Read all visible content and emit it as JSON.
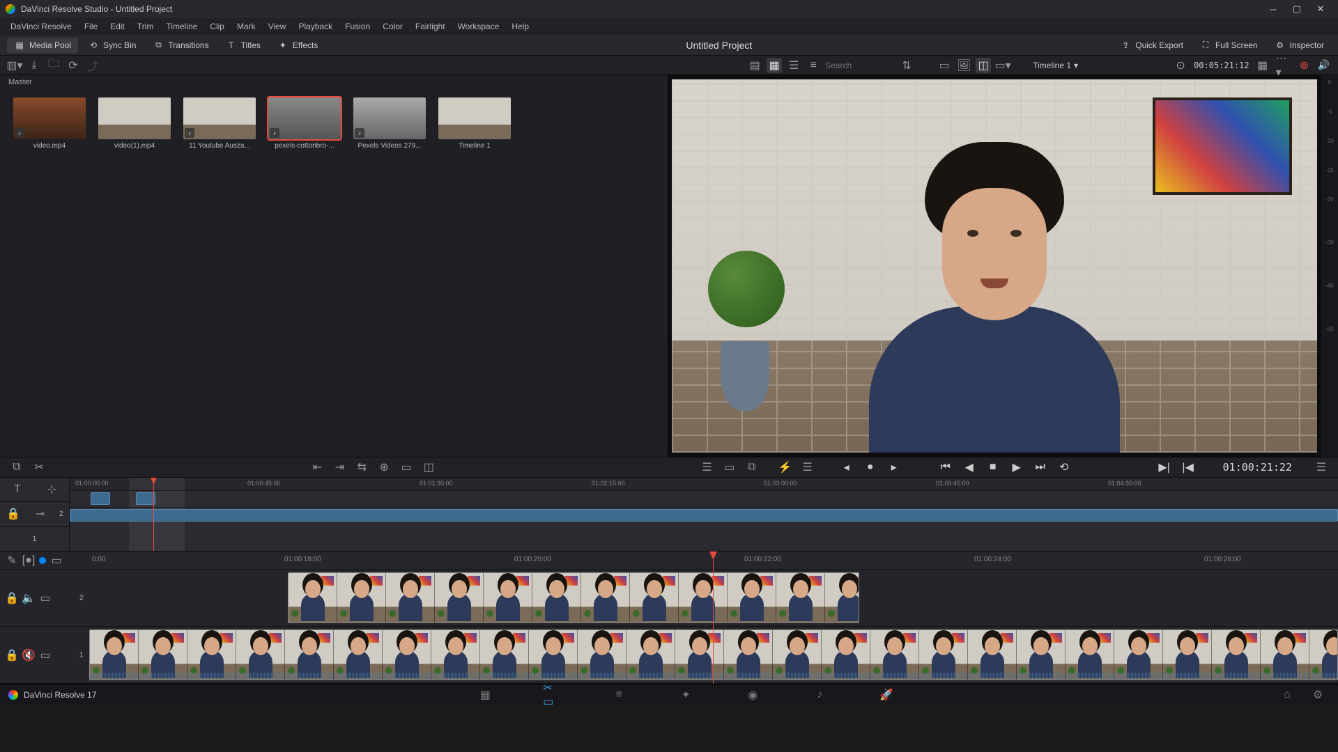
{
  "app": {
    "title": "DaVinci Resolve Studio - Untitled Project",
    "project_name": "Untitled Project",
    "version_label": "DaVinci Resolve 17"
  },
  "menu": [
    "DaVinci Resolve",
    "File",
    "Edit",
    "Trim",
    "Timeline",
    "Clip",
    "Mark",
    "View",
    "Playback",
    "Fusion",
    "Color",
    "Fairlight",
    "Workspace",
    "Help"
  ],
  "toolbar": {
    "media_pool": "Media Pool",
    "sync_bin": "Sync Bin",
    "transitions": "Transitions",
    "titles": "Titles",
    "effects": "Effects",
    "quick_export": "Quick Export",
    "full_screen": "Full Screen",
    "inspector": "Inspector"
  },
  "secondbar": {
    "search_placeholder": "Search",
    "timeline_name": "Timeline 1",
    "source_timecode": "00:05:21:12"
  },
  "media": {
    "bin_label": "Master",
    "items": [
      {
        "label": "video.mp4",
        "audio": true
      },
      {
        "label": "video(1).mp4",
        "audio": false
      },
      {
        "label": "11 Youtube Ausza...",
        "audio": true
      },
      {
        "label": "pexels-cottonbro-...",
        "audio": true,
        "selected": true
      },
      {
        "label": "Pexels Videos 279...",
        "audio": true
      },
      {
        "label": "Timeline 1",
        "audio": false
      }
    ]
  },
  "transport": {
    "timecode": "01:00:21:22"
  },
  "overview": {
    "ticks": [
      "01:00:00:00",
      "01:00:45:00",
      "01:01:30:00",
      "01:02:15:00",
      "01:03:00:00",
      "01:03:45:00",
      "01:04:30:00"
    ],
    "track2_num": "2",
    "track1_num": "1"
  },
  "detail": {
    "ticks": [
      "0:00",
      "01:00:18:00",
      "01:00:20:00",
      "01:00:22:00",
      "01:00:24:00",
      "01:00:26:00"
    ],
    "track2_num": "2",
    "track1_num": "1"
  },
  "audio_scale": [
    "0",
    "-5",
    "-10",
    "-15",
    "-20",
    "-30",
    "-40",
    "-50"
  ]
}
